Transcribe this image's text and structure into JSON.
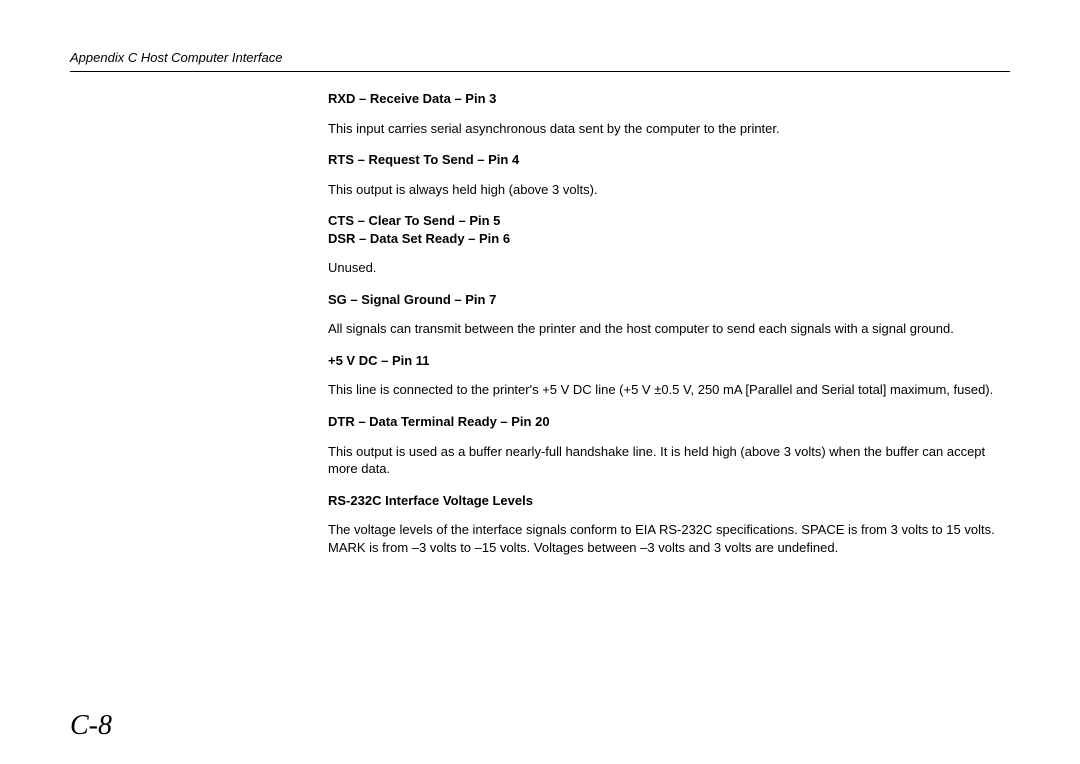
{
  "header": "Appendix C  Host Computer Interface",
  "pageNumber": "C-8",
  "sections": {
    "s1_h": "RXD – Receive Data – Pin 3",
    "s1_p": "This input carries serial asynchronous data sent by the computer to the printer.",
    "s2_h": "RTS – Request To Send – Pin 4",
    "s2_p": "This output is always held high (above 3 volts).",
    "s3_h1": "CTS – Clear To Send – Pin 5",
    "s3_h2": "DSR – Data Set Ready – Pin 6",
    "s3_p": "Unused.",
    "s4_h": "SG – Signal Ground – Pin 7",
    "s4_p": "All signals can transmit between the printer and the host computer to send each signals with a signal ground.",
    "s5_h": "+5 V DC – Pin 11",
    "s5_p": "This line is connected to the printer's +5 V DC line (+5 V ±0.5 V, 250 mA [Parallel and Serial total] maximum, fused).",
    "s6_h": "DTR – Data Terminal Ready – Pin 20",
    "s6_p": "This output is used as a buffer nearly-full handshake line. It is held high (above 3 volts) when the buffer can accept more data.",
    "s7_h": "RS-232C Interface Voltage Levels",
    "s7_p": "The voltage levels of the interface signals conform to EIA RS-232C specifications. SPACE is from 3 volts to 15 volts. MARK is from –3 volts to –15 volts. Voltages between –3 volts and 3 volts are undefined."
  }
}
